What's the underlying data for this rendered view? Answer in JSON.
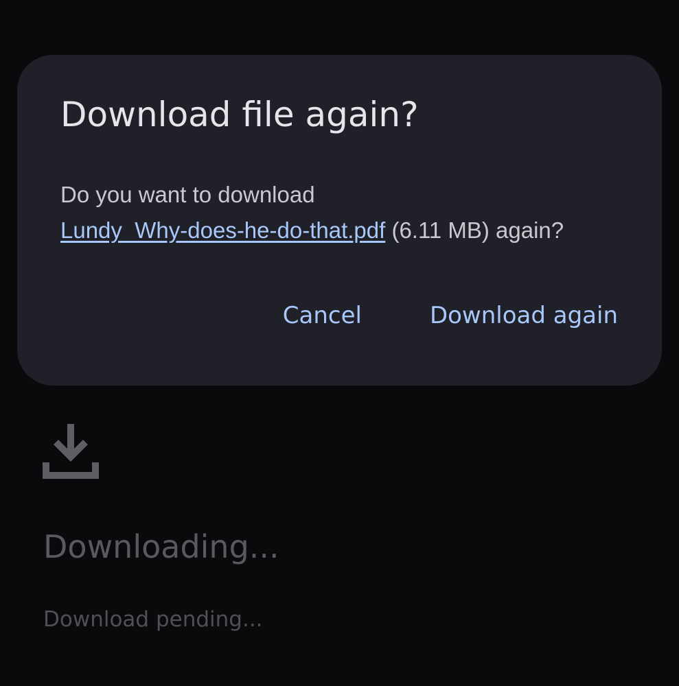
{
  "dialog": {
    "title": "Download file again?",
    "message_prefix": "Do you want to download",
    "file_name": "Lundy_Why-does-he-do-that.pdf",
    "message_suffix": " (6.11 MB) again?",
    "cancel_label": "Cancel",
    "confirm_label": "Download again"
  },
  "background": {
    "icon": "download-icon",
    "title": "Downloading...",
    "status": "Download pending..."
  },
  "colors": {
    "accent": "#a8c7fa",
    "dialog_bg": "#202128",
    "page_bg": "#0a0a0c"
  }
}
